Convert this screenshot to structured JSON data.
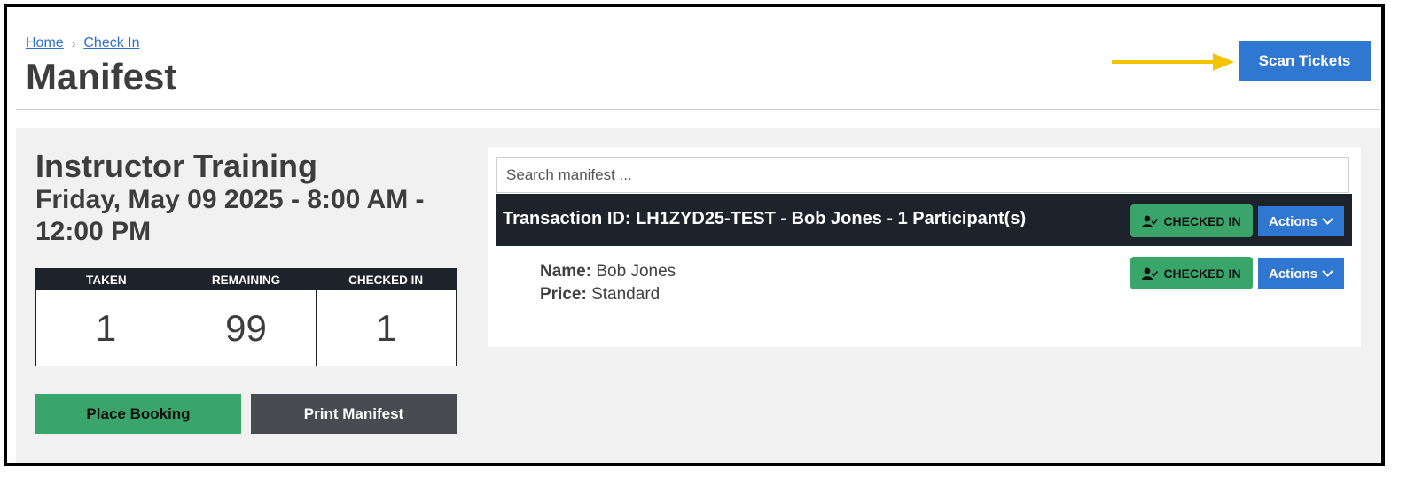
{
  "breadcrumb": {
    "home": "Home",
    "separator": "›",
    "check_in": "Check In"
  },
  "page_title": "Manifest",
  "header": {
    "scan_button": "Scan Tickets"
  },
  "event": {
    "title": "Instructor Training",
    "date": "Friday, May 09 2025 - 8:00 AM - 12:00 PM"
  },
  "stats": {
    "headers": [
      "TAKEN",
      "REMAINING",
      "CHECKED IN"
    ],
    "values": [
      "1",
      "99",
      "1"
    ]
  },
  "buttons": {
    "place_booking": "Place Booking",
    "print_manifest": "Print Manifest"
  },
  "manifest": {
    "search_placeholder": "Search manifest ...",
    "transaction_text": "Transaction ID: LH1ZYD25-TEST - Bob Jones - 1 Participant(s)",
    "checked_in_label": "CHECKED IN",
    "actions_label": "Actions",
    "participant": {
      "name_label": "Name:",
      "name": "Bob Jones",
      "price_label": "Price:",
      "price": "Standard"
    }
  },
  "colors": {
    "accent_blue": "#2f77d0",
    "success_green": "#3aa56a",
    "dark_bar": "#1d222b",
    "arrow_yellow": "#f5c400"
  }
}
